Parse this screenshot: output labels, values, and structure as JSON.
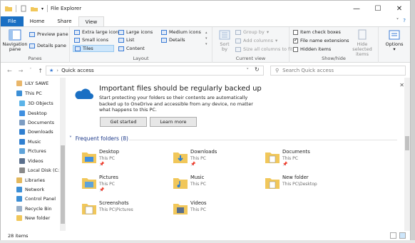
{
  "window": {
    "title": "File Explorer"
  },
  "tabs": [
    "File",
    "Home",
    "Share",
    "View"
  ],
  "ribbon": {
    "panes": {
      "navigation_pane": "Navigation pane",
      "preview_pane": "Preview pane",
      "details_pane": "Details pane",
      "group_label": "Panes"
    },
    "layout": {
      "items": [
        "Extra large icons",
        "Large icons",
        "Medium icons",
        "Small icons",
        "List",
        "Details",
        "Tiles",
        "Content"
      ],
      "group_label": "Layout"
    },
    "current_view": {
      "sort_by": "Sort by",
      "group_by": "Group by",
      "add_columns": "Add columns",
      "size_all_columns": "Size all columns to fit",
      "group_label": "Current view"
    },
    "show_hide": {
      "item_check_boxes": "Item check boxes",
      "file_name_extensions": "File name extensions",
      "hidden_items": "Hidden items",
      "hide_selected": "Hide selected items",
      "group_label": "Show/hide"
    },
    "options": "Options"
  },
  "address": {
    "path": "Quick access",
    "search_placeholder": "Search Quick access"
  },
  "nav": [
    {
      "label": "LILY SAWE",
      "color": "#e9b66a"
    },
    {
      "label": "This PC",
      "color": "#3c8fd6"
    },
    {
      "label": "3D Objects",
      "color": "#5bb3e8"
    },
    {
      "label": "Desktop",
      "color": "#3f8fe0"
    },
    {
      "label": "Documents",
      "color": "#7c9cc2"
    },
    {
      "label": "Downloads",
      "color": "#2f7fd0"
    },
    {
      "label": "Music",
      "color": "#2f7fd0"
    },
    {
      "label": "Pictures",
      "color": "#5fa3d9"
    },
    {
      "label": "Videos",
      "color": "#5a6f8c"
    },
    {
      "label": "Local Disk (C:)",
      "color": "#8a8a8a"
    },
    {
      "label": "Libraries",
      "color": "#e3b85e"
    },
    {
      "label": "Network",
      "color": "#3c8fd6"
    },
    {
      "label": "Control Panel",
      "color": "#3c8fd6"
    },
    {
      "label": "Recycle Bin",
      "color": "#9ab0c8"
    },
    {
      "label": "New folder",
      "color": "#f1c75a"
    }
  ],
  "banner": {
    "title": "Important files should be regularly backed up",
    "body": "Start protecting your folders so their contents are automatically backed up to OneDrive and accessible from any device, no matter what happens to this PC.",
    "get_started": "Get started",
    "learn_more": "Learn more"
  },
  "frequent": {
    "header": "Frequent folders (8)",
    "folders": [
      {
        "name": "Desktop",
        "location": "This PC",
        "pinned": true
      },
      {
        "name": "Downloads",
        "location": "This PC",
        "pinned": true
      },
      {
        "name": "Documents",
        "location": "This PC",
        "pinned": true
      },
      {
        "name": "Pictures",
        "location": "This PC",
        "pinned": true
      },
      {
        "name": "Music",
        "location": "This PC",
        "pinned": false
      },
      {
        "name": "New folder",
        "location": "This PC\\Desktop",
        "pinned": false
      },
      {
        "name": "Screenshots",
        "location": "This PC\\Pictures",
        "pinned": false
      },
      {
        "name": "Videos",
        "location": "This PC",
        "pinned": false
      }
    ]
  },
  "status": {
    "items": "28 items"
  },
  "colors": {
    "accent": "#1a6fc3",
    "folder": "#f1c75a",
    "link": "#1e3a8a"
  }
}
